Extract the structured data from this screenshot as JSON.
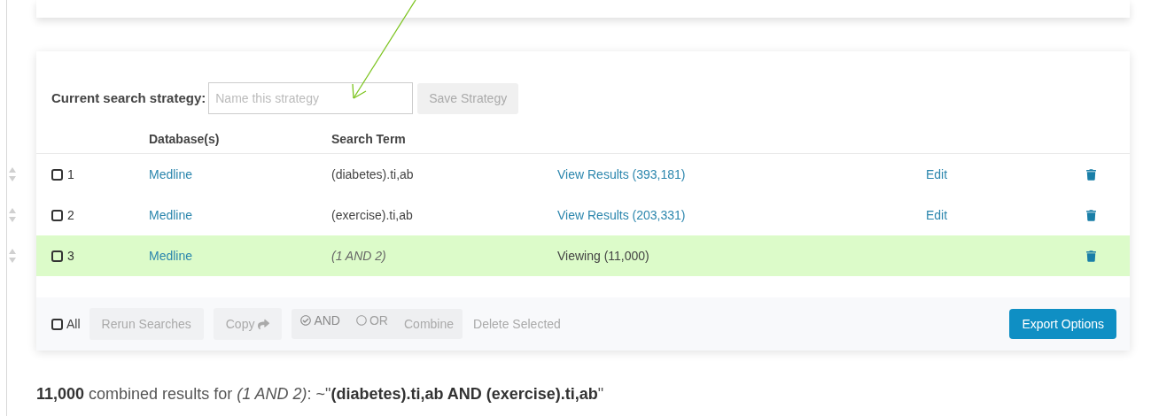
{
  "strategy": {
    "label": "Current search strategy:",
    "placeholder": "Name this strategy",
    "save_button": "Save Strategy"
  },
  "table": {
    "columns": [
      "Database(s)",
      "Search Term"
    ],
    "rows": [
      {
        "number": "1",
        "checked": false,
        "database": "Medline",
        "term": "(diabetes).ti,ab",
        "kind": "results",
        "results": "View Results (393,181)",
        "edit": "Edit",
        "selected": false
      },
      {
        "number": "2",
        "checked": false,
        "database": "Medline",
        "term": "(exercise).ti,ab",
        "kind": "results",
        "results": "View Results (203,331)",
        "edit": "Edit",
        "selected": false
      },
      {
        "number": "3",
        "checked": false,
        "database": "Medline",
        "term": "(1 AND 2)",
        "kind": "viewing",
        "results": "Viewing (11,000)",
        "selected": true
      }
    ]
  },
  "footer": {
    "all": {
      "label": "All",
      "checked": false
    },
    "rerun": {
      "label": "Rerun Searches",
      "disabled": true
    },
    "copy": {
      "label": "Copy",
      "disabled": true
    },
    "operators": [
      {
        "label": "AND",
        "selected": true
      },
      {
        "label": "OR",
        "selected": false
      }
    ],
    "combine": {
      "label": "Combine",
      "disabled": true
    },
    "delete": {
      "label": "Delete Selected",
      "disabled": true
    },
    "export": {
      "label": "Export Options",
      "disabled": false
    }
  },
  "summary": "**11,000** combined results for *(1 AND 2)*: ~\"**(diabetes).ti,ab AND (exercise).ti,ab**\""
}
